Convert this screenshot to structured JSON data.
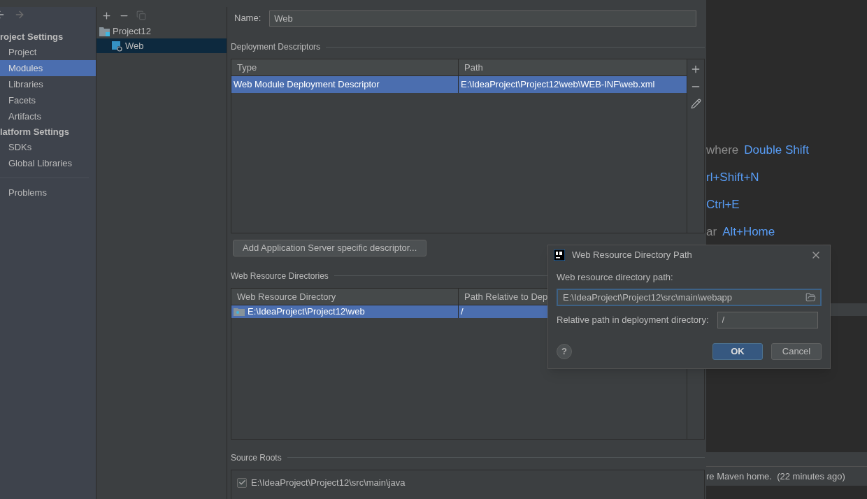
{
  "sidebar": {
    "sections": [
      {
        "title": "roject Settings",
        "items": [
          {
            "label": "Project",
            "selected": false
          },
          {
            "label": "Modules",
            "selected": true
          },
          {
            "label": "Libraries",
            "selected": false
          },
          {
            "label": "Facets",
            "selected": false
          },
          {
            "label": "Artifacts",
            "selected": false
          }
        ]
      },
      {
        "title": "latform Settings",
        "items": [
          {
            "label": "SDKs",
            "selected": false
          },
          {
            "label": "Global Libraries",
            "selected": false
          }
        ]
      }
    ],
    "footer_items": [
      {
        "label": "Problems",
        "selected": false
      }
    ]
  },
  "module_tree": [
    {
      "label": "Project12",
      "kind": "project",
      "selected": false,
      "children": [
        {
          "label": "Web",
          "kind": "web",
          "selected": true
        }
      ]
    }
  ],
  "name_field": {
    "label": "Name:",
    "value": "Web"
  },
  "deployment_descriptors": {
    "title": "Deployment Descriptors",
    "columns": [
      "Type",
      "Path"
    ],
    "rows": [
      {
        "cells": [
          "Web Module Deployment Descriptor",
          "E:\\IdeaProject\\Project12\\web\\WEB-INF\\web.xml"
        ],
        "selected": true
      }
    ]
  },
  "add_descriptor_button": "Add Application Server specific descriptor...",
  "web_resource_directories": {
    "title": "Web Resource Directories",
    "columns": [
      "Web Resource Directory",
      "Path Relative to Dep"
    ],
    "rows": [
      {
        "cells": [
          "E:\\IdeaProject\\Project12\\web",
          "/"
        ],
        "selected": true
      }
    ]
  },
  "source_roots": {
    "title": "Source Roots",
    "items": [
      {
        "label": "E:\\IdeaProject\\Project12\\src\\main\\java",
        "checked": true
      }
    ]
  },
  "background_hints": [
    {
      "action": "where",
      "shortcut": "Double Shift"
    },
    {
      "shortcut": "rl+Shift+N"
    },
    {
      "shortcut": "Ctrl+E"
    },
    {
      "action": "ar",
      "shortcut": "Alt+Home"
    }
  ],
  "background_status": "re Maven home.  (22 minutes ago)",
  "dialog": {
    "title": "Web Resource Directory Path",
    "path_label": "Web resource directory path:",
    "path_value": "E:\\IdeaProject\\Project12\\src\\main\\webapp",
    "relative_label": "Relative path in deployment directory:",
    "relative_value": "/",
    "help": "?",
    "buttons": [
      {
        "label": "OK",
        "kind": "primary"
      },
      {
        "label": "Cancel",
        "kind": "secondary"
      }
    ]
  }
}
